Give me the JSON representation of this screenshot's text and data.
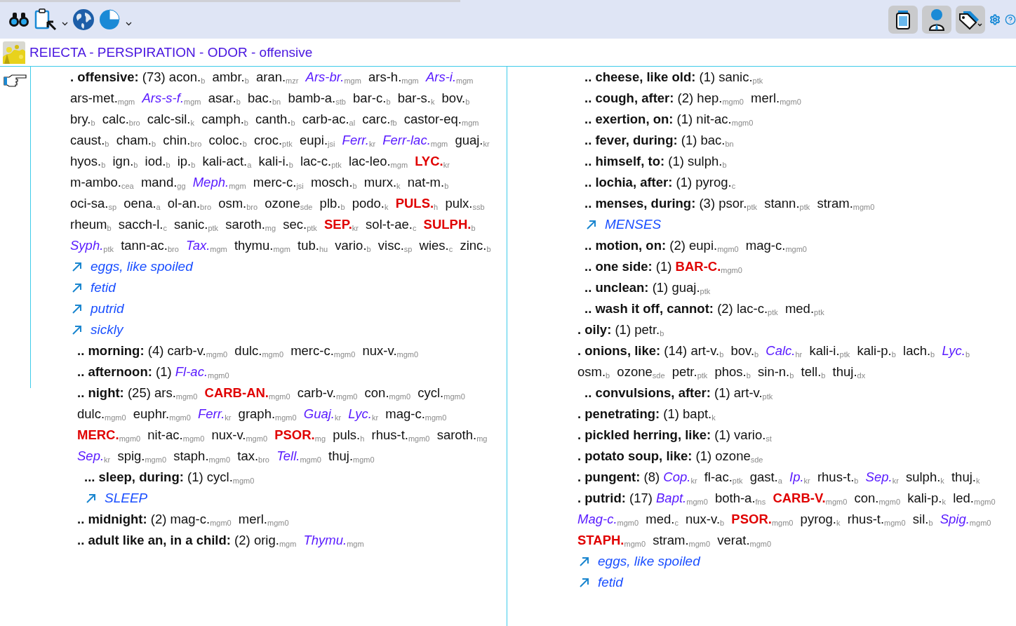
{
  "title": "REIECTA - PERSPIRATION - ODOR - offensive",
  "columns": [
    {
      "entries": [
        {
          "kind": "rubric",
          "label": ". offensive:",
          "count": "(73)",
          "remedies": [
            {
              "name": "acon.",
              "source": "b",
              "kind": "plain"
            },
            {
              "name": "ambr.",
              "source": "b",
              "kind": "plain"
            },
            {
              "name": "aran.",
              "source": "mzr",
              "kind": "plain"
            },
            {
              "name": "Ars-br.",
              "source": "mgm",
              "kind": "italic"
            },
            {
              "name": "ars-h.",
              "source": "mgm",
              "kind": "plain"
            },
            {
              "name": "Ars-i.",
              "source": "mgm",
              "kind": "italic"
            },
            {
              "name": "ars-met.",
              "source": "mgm",
              "kind": "plain"
            },
            {
              "name": "Ars-s-f.",
              "source": "mgm",
              "kind": "italic"
            },
            {
              "name": "asar.",
              "source": "b",
              "kind": "plain"
            },
            {
              "name": "bac.",
              "source": "bn",
              "kind": "plain"
            },
            {
              "name": "bamb-a.",
              "source": "stb",
              "kind": "plain"
            },
            {
              "name": "bar-c.",
              "source": "b",
              "kind": "plain"
            },
            {
              "name": "bar-s.",
              "source": "k",
              "kind": "plain"
            },
            {
              "name": "bov.",
              "source": "b",
              "kind": "plain"
            },
            {
              "name": "bry.",
              "source": "b",
              "kind": "plain"
            },
            {
              "name": "calc.",
              "source": "bro",
              "kind": "plain"
            },
            {
              "name": "calc-sil.",
              "source": "k",
              "kind": "plain"
            },
            {
              "name": "camph.",
              "source": "b",
              "kind": "plain"
            },
            {
              "name": "canth.",
              "source": "b",
              "kind": "plain"
            },
            {
              "name": "carb-ac.",
              "source": "al",
              "kind": "plain"
            },
            {
              "name": "carc.",
              "source": "fb",
              "kind": "plain"
            },
            {
              "name": "castor-eq.",
              "source": "mgm",
              "kind": "plain"
            },
            {
              "name": "caust.",
              "source": "b",
              "kind": "plain"
            },
            {
              "name": "cham.",
              "source": "b",
              "kind": "plain"
            },
            {
              "name": "chin.",
              "source": "bro",
              "kind": "plain"
            },
            {
              "name": "coloc.",
              "source": "b",
              "kind": "plain"
            },
            {
              "name": "croc.",
              "source": "ptk",
              "kind": "plain"
            },
            {
              "name": "eupi.",
              "source": "jsi",
              "kind": "plain"
            },
            {
              "name": "Ferr.",
              "source": "kr",
              "kind": "italic"
            },
            {
              "name": "Ferr-lac.",
              "source": "mgm",
              "kind": "italic"
            },
            {
              "name": "guaj.",
              "source": "kr",
              "kind": "plain"
            },
            {
              "name": "hyos.",
              "source": "b",
              "kind": "plain"
            },
            {
              "name": "ign.",
              "source": "b",
              "kind": "plain"
            },
            {
              "name": "iod.",
              "source": "b",
              "kind": "plain"
            },
            {
              "name": "ip.",
              "source": "b",
              "kind": "plain"
            },
            {
              "name": "kali-act.",
              "source": "a",
              "kind": "plain"
            },
            {
              "name": "kali-i.",
              "source": "b",
              "kind": "plain"
            },
            {
              "name": "lac-c.",
              "source": "ptk",
              "kind": "plain"
            },
            {
              "name": "lac-leo.",
              "source": "mgm",
              "kind": "plain"
            },
            {
              "name": "LYC.",
              "source": "kr",
              "kind": "bold"
            },
            {
              "name": "m-ambo.",
              "source": "cea",
              "kind": "plain"
            },
            {
              "name": "mand.",
              "source": "gg",
              "kind": "plain"
            },
            {
              "name": "Meph.",
              "source": "mgm",
              "kind": "italic"
            },
            {
              "name": "merc-c.",
              "source": "jsi",
              "kind": "plain"
            },
            {
              "name": "mosch.",
              "source": "b",
              "kind": "plain"
            },
            {
              "name": "murx.",
              "source": "k",
              "kind": "plain"
            },
            {
              "name": "nat-m.",
              "source": "b",
              "kind": "plain"
            },
            {
              "name": "oci-sa.",
              "source": "sp",
              "kind": "plain"
            },
            {
              "name": "oena.",
              "source": "a",
              "kind": "plain"
            },
            {
              "name": "ol-an.",
              "source": "bro",
              "kind": "plain"
            },
            {
              "name": "osm.",
              "source": "bro",
              "kind": "plain"
            },
            {
              "name": "ozone",
              "source": "sde",
              "kind": "plain"
            },
            {
              "name": "plb.",
              "source": "b",
              "kind": "plain"
            },
            {
              "name": "podo.",
              "source": "k",
              "kind": "plain"
            },
            {
              "name": "PULS.",
              "source": "h",
              "kind": "bold"
            },
            {
              "name": "pulx.",
              "source": "ssb",
              "kind": "plain"
            },
            {
              "name": "rheum",
              "source": "b",
              "kind": "plain"
            },
            {
              "name": "sacch-l.",
              "source": "c",
              "kind": "plain"
            },
            {
              "name": "sanic.",
              "source": "ptk",
              "kind": "plain"
            },
            {
              "name": "saroth.",
              "source": "mg",
              "kind": "plain"
            },
            {
              "name": "sec.",
              "source": "ptk",
              "kind": "plain"
            },
            {
              "name": "SEP.",
              "source": "kr",
              "kind": "bold"
            },
            {
              "name": "sol-t-ae.",
              "source": "c",
              "kind": "plain"
            },
            {
              "name": "SULPH.",
              "source": "b",
              "kind": "bold"
            },
            {
              "name": "Syph.",
              "source": "ptk",
              "kind": "italic"
            },
            {
              "name": "tann-ac.",
              "source": "bro",
              "kind": "plain"
            },
            {
              "name": "Tax.",
              "source": "mgm",
              "kind": "italic"
            },
            {
              "name": "thymu.",
              "source": "mgm",
              "kind": "plain"
            },
            {
              "name": "tub.",
              "source": "hu",
              "kind": "plain"
            },
            {
              "name": "vario.",
              "source": "b",
              "kind": "plain"
            },
            {
              "name": "visc.",
              "source": "sp",
              "kind": "plain"
            },
            {
              "name": "wies.",
              "source": "c",
              "kind": "plain"
            },
            {
              "name": "zinc.",
              "source": "b",
              "kind": "plain"
            }
          ],
          "see_also": [
            "eggs, like spoiled",
            "fetid",
            "putrid",
            "sickly"
          ],
          "children": [
            {
              "kind": "rubric",
              "label": ".. morning:",
              "count": "(4)",
              "remedies": [
                {
                  "name": "carb-v.",
                  "source": "mgm0",
                  "kind": "plain"
                },
                {
                  "name": "dulc.",
                  "source": "mgm0",
                  "kind": "plain"
                },
                {
                  "name": "merc-c.",
                  "source": "mgm0",
                  "kind": "plain"
                },
                {
                  "name": "nux-v.",
                  "source": "mgm0",
                  "kind": "plain"
                }
              ]
            },
            {
              "kind": "rubric",
              "label": ".. afternoon:",
              "count": "(1)",
              "remedies": [
                {
                  "name": "Fl-ac.",
                  "source": "mgm0",
                  "kind": "italic"
                }
              ]
            },
            {
              "kind": "rubric",
              "label": ".. night:",
              "count": "(25)",
              "remedies": [
                {
                  "name": "ars.",
                  "source": "mgm0",
                  "kind": "plain"
                },
                {
                  "name": "CARB-AN.",
                  "source": "mgm0",
                  "kind": "bold"
                },
                {
                  "name": "carb-v.",
                  "source": "mgm0",
                  "kind": "plain"
                },
                {
                  "name": "con.",
                  "source": "mgm0",
                  "kind": "plain"
                },
                {
                  "name": "cycl.",
                  "source": "mgm0",
                  "kind": "plain"
                },
                {
                  "name": "dulc.",
                  "source": "mgm0",
                  "kind": "plain"
                },
                {
                  "name": "euphr.",
                  "source": "mgm0",
                  "kind": "plain"
                },
                {
                  "name": "Ferr.",
                  "source": "kr",
                  "kind": "italic"
                },
                {
                  "name": "graph.",
                  "source": "mgm0",
                  "kind": "plain"
                },
                {
                  "name": "Guaj.",
                  "source": "kr",
                  "kind": "italic"
                },
                {
                  "name": "Lyc.",
                  "source": "kr",
                  "kind": "italic"
                },
                {
                  "name": "mag-c.",
                  "source": "mgm0",
                  "kind": "plain"
                },
                {
                  "name": "MERC.",
                  "source": "mgm0",
                  "kind": "bold"
                },
                {
                  "name": "nit-ac.",
                  "source": "mgm0",
                  "kind": "plain"
                },
                {
                  "name": "nux-v.",
                  "source": "mgm0",
                  "kind": "plain"
                },
                {
                  "name": "PSOR.",
                  "source": "mg",
                  "kind": "bold"
                },
                {
                  "name": "puls.",
                  "source": "h",
                  "kind": "plain"
                },
                {
                  "name": "rhus-t.",
                  "source": "mgm0",
                  "kind": "plain"
                },
                {
                  "name": "saroth.",
                  "source": "mg",
                  "kind": "plain"
                },
                {
                  "name": "Sep.",
                  "source": "kr",
                  "kind": "italic"
                },
                {
                  "name": "spig.",
                  "source": "mgm0",
                  "kind": "plain"
                },
                {
                  "name": "staph.",
                  "source": "mgm0",
                  "kind": "plain"
                },
                {
                  "name": "tax.",
                  "source": "bro",
                  "kind": "plain"
                },
                {
                  "name": "Tell.",
                  "source": "mgm0",
                  "kind": "italic"
                },
                {
                  "name": "thuj.",
                  "source": "mgm0",
                  "kind": "plain"
                }
              ],
              "children": [
                {
                  "kind": "rubric",
                  "label": "... sleep, during:",
                  "count": "(1)",
                  "remedies": [
                    {
                      "name": "cycl.",
                      "source": "mgm0",
                      "kind": "plain"
                    }
                  ],
                  "see_also": [
                    "SLEEP"
                  ]
                }
              ]
            },
            {
              "kind": "rubric",
              "label": ".. midnight:",
              "count": "(2)",
              "remedies": [
                {
                  "name": "mag-c.",
                  "source": "mgm0",
                  "kind": "plain"
                },
                {
                  "name": "merl.",
                  "source": "mgm0",
                  "kind": "plain"
                }
              ]
            },
            {
              "kind": "rubric",
              "label": ".. adult like an, in a child:",
              "count": "(2)",
              "remedies": [
                {
                  "name": "orig.",
                  "source": "mgm",
                  "kind": "plain"
                },
                {
                  "name": "Thymu.",
                  "source": "mgm",
                  "kind": "italic"
                }
              ]
            }
          ]
        }
      ]
    },
    {
      "entries": [
        {
          "kind": "continued",
          "children": [
            {
              "kind": "rubric",
              "label": ".. cheese, like old:",
              "count": "(1)",
              "remedies": [
                {
                  "name": "sanic.",
                  "source": "ptk",
                  "kind": "plain"
                }
              ]
            },
            {
              "kind": "rubric",
              "label": ".. cough, after:",
              "count": "(2)",
              "remedies": [
                {
                  "name": "hep.",
                  "source": "mgm0",
                  "kind": "plain"
                },
                {
                  "name": "merl.",
                  "source": "mgm0",
                  "kind": "plain"
                }
              ]
            },
            {
              "kind": "rubric",
              "label": ".. exertion, on:",
              "count": "(1)",
              "remedies": [
                {
                  "name": "nit-ac.",
                  "source": "mgm0",
                  "kind": "plain"
                }
              ]
            },
            {
              "kind": "rubric",
              "label": ".. fever, during:",
              "count": "(1)",
              "remedies": [
                {
                  "name": "bac.",
                  "source": "bn",
                  "kind": "plain"
                }
              ]
            },
            {
              "kind": "rubric",
              "label": ".. himself, to:",
              "count": "(1)",
              "remedies": [
                {
                  "name": "sulph.",
                  "source": "b",
                  "kind": "plain"
                }
              ]
            },
            {
              "kind": "rubric",
              "label": ".. lochia, after:",
              "count": "(1)",
              "remedies": [
                {
                  "name": "pyrog.",
                  "source": "c",
                  "kind": "plain"
                }
              ]
            },
            {
              "kind": "rubric",
              "label": ".. menses, during:",
              "count": "(3)",
              "remedies": [
                {
                  "name": "psor.",
                  "source": "ptk",
                  "kind": "plain"
                },
                {
                  "name": "stann.",
                  "source": "ptk",
                  "kind": "plain"
                },
                {
                  "name": "stram.",
                  "source": "mgm0",
                  "kind": "plain"
                }
              ],
              "see_also": [
                "MENSES"
              ]
            },
            {
              "kind": "rubric",
              "label": ".. motion, on:",
              "count": "(2)",
              "remedies": [
                {
                  "name": "eupi.",
                  "source": "mgm0",
                  "kind": "plain"
                },
                {
                  "name": "mag-c.",
                  "source": "mgm0",
                  "kind": "plain"
                }
              ]
            },
            {
              "kind": "rubric",
              "label": ".. one side:",
              "count": "(1)",
              "remedies": [
                {
                  "name": "BAR-C.",
                  "source": "mgm0",
                  "kind": "bold"
                }
              ]
            },
            {
              "kind": "rubric",
              "label": ".. unclean:",
              "count": "(1)",
              "remedies": [
                {
                  "name": "guaj.",
                  "source": "ptk",
                  "kind": "plain"
                }
              ]
            },
            {
              "kind": "rubric",
              "label": ".. wash it off, cannot:",
              "count": "(2)",
              "remedies": [
                {
                  "name": "lac-c.",
                  "source": "ptk",
                  "kind": "plain"
                },
                {
                  "name": "med.",
                  "source": "ptk",
                  "kind": "plain"
                }
              ]
            }
          ]
        },
        {
          "kind": "rubric",
          "label": ". oily:",
          "count": "(1)",
          "remedies": [
            {
              "name": "petr.",
              "source": "b",
              "kind": "plain"
            }
          ]
        },
        {
          "kind": "rubric",
          "label": ". onions, like:",
          "count": "(14)",
          "remedies": [
            {
              "name": "art-v.",
              "source": "b",
              "kind": "plain"
            },
            {
              "name": "bov.",
              "source": "b",
              "kind": "plain"
            },
            {
              "name": "Calc.",
              "source": "hr",
              "kind": "italic"
            },
            {
              "name": "kali-i.",
              "source": "ptk",
              "kind": "plain"
            },
            {
              "name": "kali-p.",
              "source": "b",
              "kind": "plain"
            },
            {
              "name": "lach.",
              "source": "b",
              "kind": "plain"
            },
            {
              "name": "Lyc.",
              "source": "b",
              "kind": "italic"
            },
            {
              "name": "osm.",
              "source": "b",
              "kind": "plain"
            },
            {
              "name": "ozone",
              "source": "sde",
              "kind": "plain"
            },
            {
              "name": "petr.",
              "source": "ptk",
              "kind": "plain"
            },
            {
              "name": "phos.",
              "source": "b",
              "kind": "plain"
            },
            {
              "name": "sin-n.",
              "source": "b",
              "kind": "plain"
            },
            {
              "name": "tell.",
              "source": "b",
              "kind": "plain"
            },
            {
              "name": "thuj.",
              "source": "dx",
              "kind": "plain"
            }
          ],
          "children": [
            {
              "kind": "rubric",
              "label": ".. convulsions, after:",
              "count": "(1)",
              "remedies": [
                {
                  "name": "art-v.",
                  "source": "ptk",
                  "kind": "plain"
                }
              ]
            }
          ]
        },
        {
          "kind": "rubric",
          "label": ". penetrating:",
          "count": "(1)",
          "remedies": [
            {
              "name": "bapt.",
              "source": "k",
              "kind": "plain"
            }
          ]
        },
        {
          "kind": "rubric",
          "label": ". pickled herring, like:",
          "count": "(1)",
          "remedies": [
            {
              "name": "vario.",
              "source": "st",
              "kind": "plain"
            }
          ]
        },
        {
          "kind": "rubric",
          "label": ". potato soup, like:",
          "count": "(1)",
          "remedies": [
            {
              "name": "ozone",
              "source": "sde",
              "kind": "plain"
            }
          ]
        },
        {
          "kind": "rubric",
          "label": ". pungent:",
          "count": "(8)",
          "remedies": [
            {
              "name": "Cop.",
              "source": "kr",
              "kind": "italic"
            },
            {
              "name": "fl-ac.",
              "source": "ptk",
              "kind": "plain"
            },
            {
              "name": "gast.",
              "source": "a",
              "kind": "plain"
            },
            {
              "name": "Ip.",
              "source": "kr",
              "kind": "italic"
            },
            {
              "name": "rhus-t.",
              "source": "b",
              "kind": "plain"
            },
            {
              "name": "Sep.",
              "source": "kr",
              "kind": "italic"
            },
            {
              "name": "sulph.",
              "source": "k",
              "kind": "plain"
            },
            {
              "name": "thuj.",
              "source": "k",
              "kind": "plain"
            }
          ]
        },
        {
          "kind": "rubric",
          "label": ". putrid:",
          "count": "(17)",
          "remedies": [
            {
              "name": "Bapt.",
              "source": "mgm0",
              "kind": "italic"
            },
            {
              "name": "both-a.",
              "source": "fns",
              "kind": "plain"
            },
            {
              "name": "CARB-V.",
              "source": "mgm0",
              "kind": "bold"
            },
            {
              "name": "con.",
              "source": "mgm0",
              "kind": "plain"
            },
            {
              "name": "kali-p.",
              "source": "k",
              "kind": "plain"
            },
            {
              "name": "led.",
              "source": "mgm0",
              "kind": "plain"
            },
            {
              "name": "Mag-c.",
              "source": "mgm0",
              "kind": "italic"
            },
            {
              "name": "med.",
              "source": "c",
              "kind": "plain"
            },
            {
              "name": "nux-v.",
              "source": "b",
              "kind": "plain"
            },
            {
              "name": "PSOR.",
              "source": "mgm0",
              "kind": "bold"
            },
            {
              "name": "pyrog.",
              "source": "k",
              "kind": "plain"
            },
            {
              "name": "rhus-t.",
              "source": "mgm0",
              "kind": "plain"
            },
            {
              "name": "sil.",
              "source": "b",
              "kind": "plain"
            },
            {
              "name": "Spig.",
              "source": "mgm0",
              "kind": "italic"
            },
            {
              "name": "STAPH.",
              "source": "mgm0",
              "kind": "bold"
            },
            {
              "name": "stram.",
              "source": "mgm0",
              "kind": "plain"
            },
            {
              "name": "verat.",
              "source": "mgm0",
              "kind": "plain"
            }
          ],
          "see_also": [
            "eggs, like spoiled",
            "fetid"
          ]
        }
      ]
    }
  ]
}
